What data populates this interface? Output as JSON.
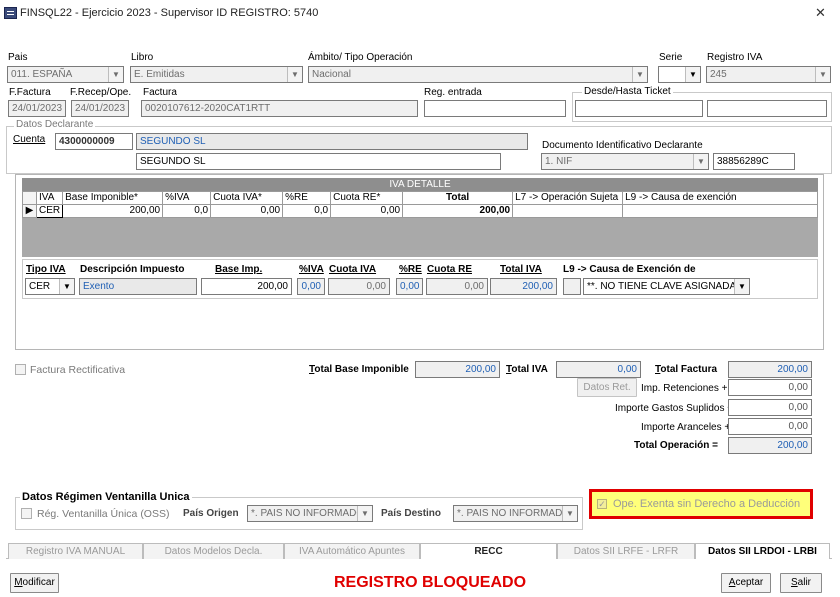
{
  "window": {
    "title": "FINSQL22 - Ejercicio 2023 - Supervisor ID REGISTRO: 5740",
    "icon": "app-icon",
    "close_label": "✕"
  },
  "header": {
    "pais": {
      "label": "Pais",
      "value": "011. ESPAÑA"
    },
    "libro": {
      "label": "Libro",
      "value": "E. Emitidas"
    },
    "ambito": {
      "label": "Ámbito/ Tipo Operación",
      "value": "Nacional"
    },
    "serie": {
      "label": "Serie",
      "value": ""
    },
    "registro_iva": {
      "label": "Registro IVA",
      "value": "245"
    },
    "f_factura": {
      "label": "F.Factura",
      "value": "24/01/2023"
    },
    "f_recep": {
      "label": "F.Recep/Ope.",
      "value": "24/01/2023"
    },
    "factura": {
      "label": "Factura",
      "value": "0020107612-2020CAT1RTT"
    },
    "reg_entrada": {
      "label": "Reg. entrada",
      "value": ""
    },
    "ticket": {
      "label": "Desde/Hasta Ticket",
      "from": "",
      "to": ""
    }
  },
  "declarante": {
    "group_label": "Datos Declarante",
    "cuenta_label": "Cuenta",
    "cuenta": "4300000009",
    "cuenta_name": "SEGUNDO SL",
    "name": "SEGUNDO SL",
    "doc_label": "Documento Identificativo Declarante",
    "doc_type": "1. NIF",
    "doc_number": "38856289C"
  },
  "iva_detalle": {
    "title": "IVA DETALLE",
    "columns": [
      "IVA",
      "Base Imponible*",
      "%IVA",
      "Cuota IVA*",
      "%RE",
      "Cuota RE*",
      "Total",
      "L7 -> Operación Sujeta",
      "L9 -> Causa de exención"
    ],
    "rows": [
      [
        "CER",
        "200,00",
        "0,0",
        "0,00",
        "0,0",
        "0,00",
        "200,00",
        "",
        ""
      ]
    ]
  },
  "detail": {
    "labels": {
      "tipo_iva": "Tipo IVA",
      "descripcion": "Descripción Impuesto",
      "base": "Base Imp.",
      "piva": "%IVA",
      "cuota_iva": "Cuota IVA",
      "pre": "%RE",
      "cuota_re": "Cuota RE",
      "total": "Total IVA",
      "l9": "L9 -> Causa de Exención de"
    },
    "tipo_iva": "CER",
    "descripcion": "Exento",
    "base": "200,00",
    "piva": "0,00",
    "cuota_iva": "0,00",
    "pre": "0,00",
    "cuota_re": "0,00",
    "total": "200,00",
    "l9": "**. NO TIENE CLAVE ASIGNADA"
  },
  "totals": {
    "factura_rectificativa": "Factura Rectificativa",
    "total_base_label": "Total Base Imponible",
    "total_base": "200,00",
    "total_iva_label": "Total IVA",
    "total_iva": "0,00",
    "total_factura_label": "Total Factura",
    "total_factura": "200,00",
    "datos_ret": "Datos Ret.",
    "imp_retenciones_label": "Imp. Retenciones +",
    "imp_retenciones": "0,00",
    "gastos_suplidos_label": "Importe Gastos Suplidos +",
    "gastos_suplidos": "0,00",
    "aranceles_label": "Importe Aranceles +",
    "aranceles": "0,00",
    "total_operacion_label": "Total Operación =",
    "total_operacion": "200,00"
  },
  "ventanilla": {
    "title": "Datos Régimen Ventanilla Unica",
    "reg_label": "Rég. Ventanilla Única (OSS)",
    "pais_origen_label": "País Origen",
    "pais_origen": "*. PAIS NO INFORMADO",
    "pais_destino_label": "País Destino",
    "pais_destino": "*. PAIS NO INFORMADO"
  },
  "exenta": {
    "label": "Ope. Exenta sin Derecho a Deducción",
    "highlight_color": "#e00000",
    "bg": "#ffff7a"
  },
  "tabs": [
    "Registro IVA MANUAL",
    "Datos Modelos Decla.",
    "IVA Automático Apuntes",
    "RECC",
    "Datos SII LRFE - LRFR",
    "Datos SII LRDOI - LRBI"
  ],
  "footer": {
    "modificar": "Modificar",
    "status": "REGISTRO BLOQUEADO",
    "status_color": "#e00000",
    "aceptar": "Aceptar",
    "salir": "Salir"
  }
}
